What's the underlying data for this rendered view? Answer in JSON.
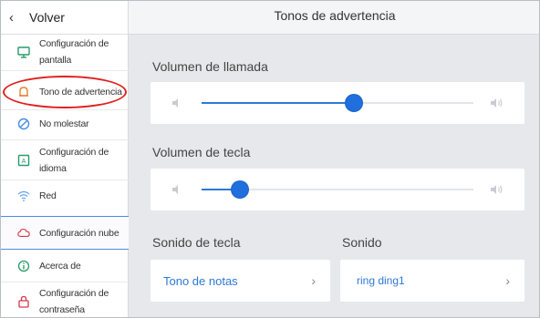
{
  "sidebar": {
    "back_label": "Volver",
    "items": [
      {
        "label": "Configuración de pantalla",
        "icon": "monitor-icon"
      },
      {
        "label": "Tono de advertencia",
        "icon": "bell-icon"
      },
      {
        "label": "No molestar",
        "icon": "do-not-disturb-icon"
      },
      {
        "label": "Configuración de idioma",
        "icon": "language-icon"
      },
      {
        "label": "Red",
        "icon": "wifi-icon"
      },
      {
        "label": "Configuración nube",
        "icon": "cloud-icon"
      },
      {
        "label": "Acerca de",
        "icon": "info-icon"
      },
      {
        "label": "Configuración de contraseña",
        "icon": "lock-icon"
      }
    ]
  },
  "header": {
    "title": "Tonos de advertencia"
  },
  "call_volume": {
    "label": "Volumen de llamada",
    "level": 0.56
  },
  "key_volume": {
    "label": "Volumen de tecla",
    "level": 0.14
  },
  "key_sound": {
    "label": "Sonido de tecla",
    "value": "Tono de notas"
  },
  "sound": {
    "label": "Sonido",
    "value": "ring ding1"
  },
  "colors": {
    "accent": "#2f78d6",
    "annotation": "#e0201e",
    "icon_orange": "#e8823a",
    "icon_blue": "#4a8ce6",
    "icon_green": "#2a9a6a",
    "icon_red": "#d43a4a"
  }
}
